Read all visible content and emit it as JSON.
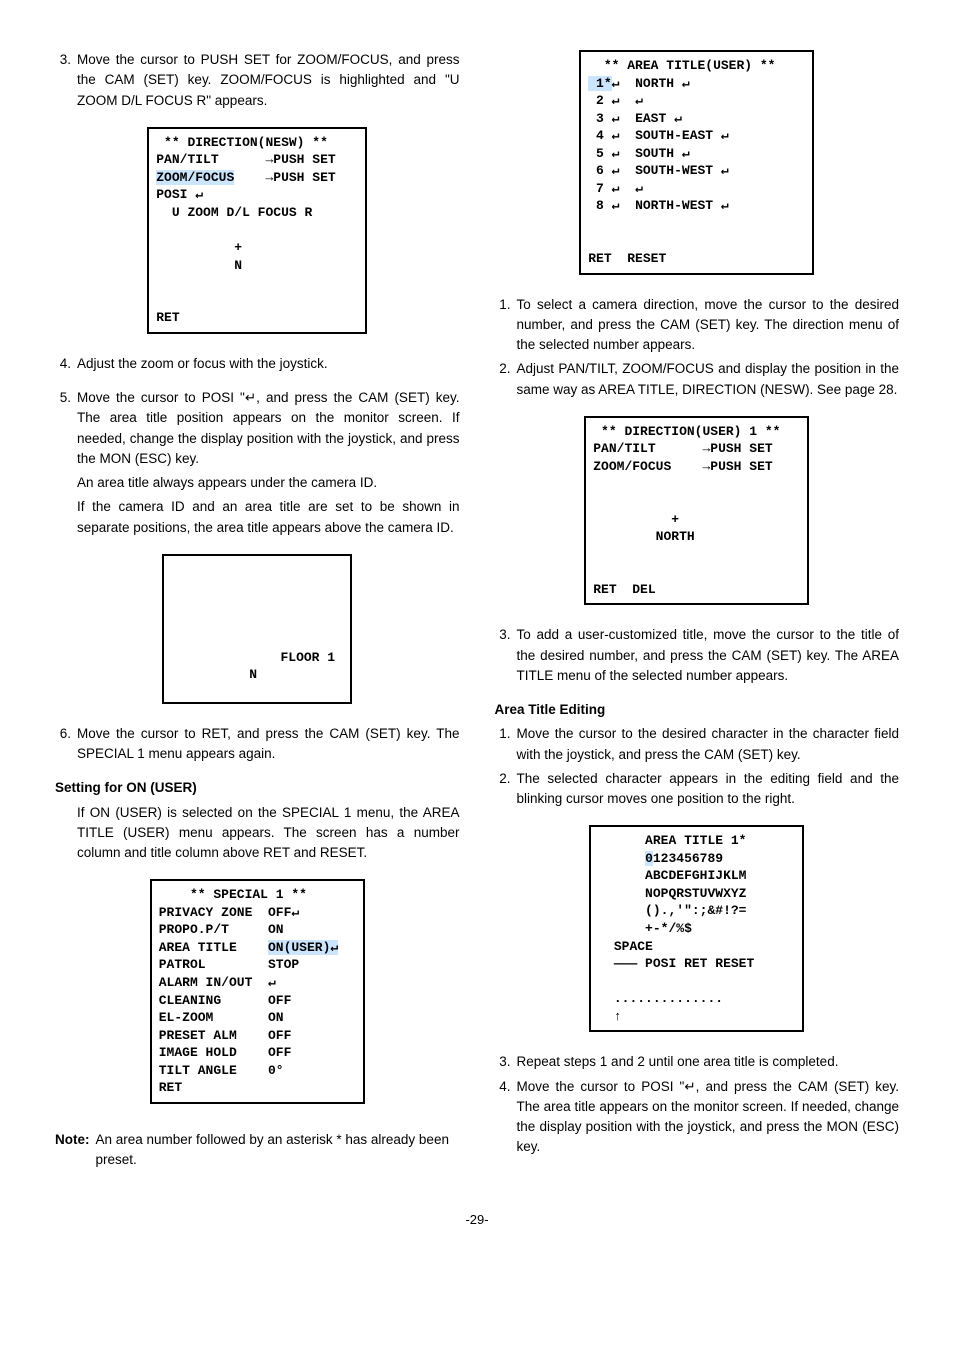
{
  "left": {
    "step3": {
      "num": "3.",
      "txt": "Move the cursor to PUSH SET for ZOOM/FOCUS, and press the CAM (SET) key. ZOOM/FOCUS is highlighted and \"U ZOOM D/L FOCUS R\" appears."
    },
    "menu1": " ** DIRECTION(NESW) **\nPAN/TILT      →PUSH SET\nZOOM/FOCUS    →PUSH SET\nPOSI ↵\n  U ZOOM D/L FOCUS R\n\n          +\n          N\n\n\nRET",
    "menu1_hl": "ZOOM/FOCUS",
    "step4": {
      "num": "4.",
      "txt": "Adjust the zoom or focus with the joystick."
    },
    "step5": {
      "num": "5.",
      "txt": "Move the cursor to POSI \"↵, and press the CAM (SET) key. The area title position appears on the monitor screen. If needed, change the display position with the joystick, and press the MON (ESC) key."
    },
    "step5a": "An area title always appears under the camera ID.",
    "step5b": "If the camera ID and an area title are set to be shown in separate positions, the area title appears above the camera ID.",
    "menu2": "\n\n\n\n\n              FLOOR 1\n          N  ",
    "step6": {
      "num": "6.",
      "txt": "Move the cursor to RET, and press the CAM (SET) key. The SPECIAL 1 menu appears again."
    },
    "heading1": "Setting for ON (USER)",
    "para1": "If ON (USER) is selected on the SPECIAL 1 menu, the AREA TITLE (USER) menu appears. The screen has a number column and title column above RET and RESET.",
    "menu3": "    ** SPECIAL 1 **\nPRIVACY ZONE  OFF↵\nPROPO.P/T     ON\nAREA TITLE    ON(USER)↵\nPATROL        STOP\nALARM IN/OUT  ↵\nCLEANING      OFF\nEL-ZOOM       ON\nPRESET ALM    OFF\nIMAGE HOLD    OFF\nTILT ANGLE    0°\nRET",
    "menu3_hl": "ON(USER)↵",
    "note_label": "Note:",
    "note_text": "An area number followed by an asterisk * has already been preset."
  },
  "right": {
    "menu4": "  ** AREA TITLE(USER) **\n 1*↵  NORTH ↵\n 2 ↵  ↵\n 3 ↵  EAST ↵\n 4 ↵  SOUTH-EAST ↵\n 5 ↵  SOUTH ↵\n 6 ↵  SOUTH-WEST ↵\n 7 ↵  ↵\n 8 ↵  NORTH-WEST ↵\n\n\nRET  RESET",
    "menu4_hl": " 1*",
    "step1": {
      "num": "1.",
      "txt": "To select a camera direction, move the cursor to the desired number, and press the CAM (SET) key. The direction menu of the selected number appears."
    },
    "step2": {
      "num": "2.",
      "txt": "Adjust PAN/TILT, ZOOM/FOCUS and display the position in the same way as AREA TITLE, DIRECTION (NESW). See page 28."
    },
    "menu5": " ** DIRECTION(USER) 1 **\nPAN/TILT      →PUSH SET\nZOOM/FOCUS    →PUSH SET\n\n\n          +\n        NORTH\n\n\nRET  DEL",
    "step3": {
      "num": "3.",
      "txt": "To add a user-customized title, move the cursor to the title of the desired number, and press the CAM (SET) key. The AREA TITLE menu of the selected number appears."
    },
    "heading1": "Area Title Editing",
    "editStep1": {
      "num": "1.",
      "txt": "Move the cursor to the desired character in the character field with the joystick, and press the CAM (SET) key."
    },
    "editStep2": {
      "num": "2.",
      "txt": "The selected character appears in the editing field and the blinking cursor moves one position to the right."
    },
    "menu6": "      AREA TITLE 1*\n      0123456789\n      ABCDEFGHIJKLM\n      NOPQRSTUVWXYZ\n      ().,'\":;&#!?=\n      +-*/%$\n  SPACE\n  ——— POSI RET RESET\n\n  ..............\n  ↑",
    "menu6_hl": "0",
    "editStep3": {
      "num": "3.",
      "txt": "Repeat steps 1 and 2 until one area title is completed."
    },
    "editStep4": {
      "num": "4.",
      "txt": "Move the cursor to POSI \"↵, and press the CAM (SET) key. The area title appears on the monitor screen. If needed, change the display position with the joystick, and press the MON (ESC) key."
    }
  },
  "page_number": "-29-"
}
